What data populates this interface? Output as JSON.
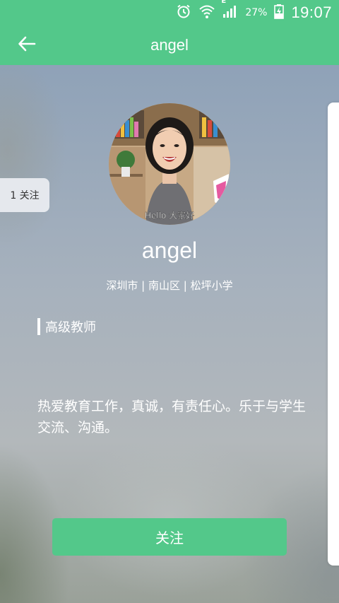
{
  "status_bar": {
    "network_label": "E",
    "battery": "27%",
    "time": "19:07"
  },
  "header": {
    "title": "angel",
    "back_icon": "arrow-left-icon"
  },
  "follow_tab": {
    "label": "1 关注"
  },
  "profile": {
    "avatar_caption": "Hello 大家好",
    "name": "angel",
    "location": "深圳市 | 南山区 | 松坪小学",
    "rank": "高级教师",
    "bio": "热爱教育工作，真诚，有责任心。乐于与学生交流、沟通。"
  },
  "actions": {
    "follow_button": "关注"
  },
  "colors": {
    "accent": "#53c88a"
  }
}
